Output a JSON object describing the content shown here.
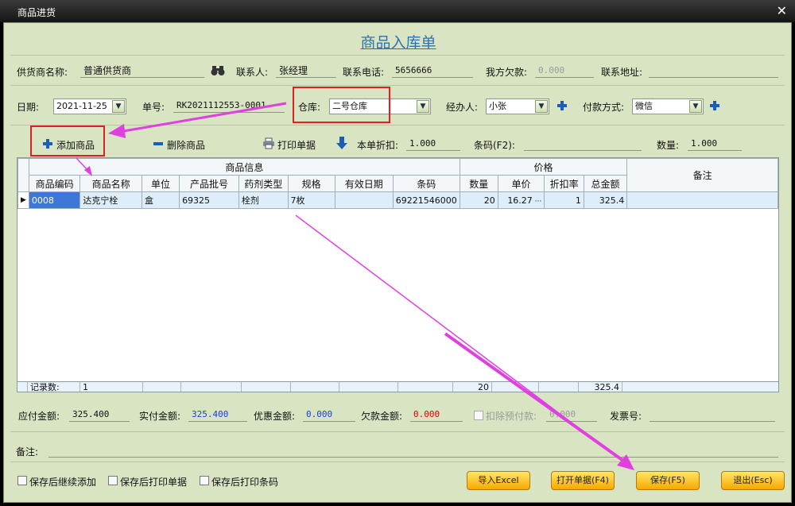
{
  "window": {
    "title": "商品进货",
    "close_glyph": "✕"
  },
  "form": {
    "heading": "商品入库单",
    "supplier_label": "供货商名称:",
    "supplier_value": "普通供货商",
    "contact_label": "联系人:",
    "contact_value": "张经理",
    "phone_label": "联系电话:",
    "phone_value": "5656666",
    "debt_label": "我方欠款:",
    "debt_value": "0.000",
    "address_label": "联系地址:",
    "address_value": "",
    "date_label": "日期:",
    "date_value": "2021-11-25",
    "order_label": "单号:",
    "order_value": "RK2021112553-0001",
    "warehouse_label": "仓库:",
    "warehouse_value": "二号仓库",
    "handler_label": "经办人:",
    "handler_value": "小张",
    "payment_label": "付款方式:",
    "payment_value": "微信"
  },
  "toolbar": {
    "add_label": "添加商品",
    "delete_label": "删除商品",
    "print_label": "打印单据",
    "discount_label": "本单折扣:",
    "discount_value": "1.000",
    "barcode_label": "条码(F2):",
    "barcode_value": "",
    "qty_label": "数量:",
    "qty_value": "1.000"
  },
  "grid": {
    "group_product": "商品信息",
    "group_price": "价格",
    "group_remark": "备注",
    "columns": [
      "商品编码",
      "商品名称",
      "单位",
      "产品批号",
      "药剂类型",
      "规格",
      "有效日期",
      "条码",
      "数量",
      "单价",
      "折扣率",
      "总金额"
    ],
    "row": {
      "code": "0008",
      "name": "达克宁栓",
      "unit": "盒",
      "batch": "69325",
      "type": "栓剂",
      "spec": "7枚",
      "expiry": "",
      "barcode": "69221546000",
      "qty": "20",
      "price": "16.27",
      "discount": "1",
      "total": "325.4"
    },
    "footer": {
      "label": "记录数:",
      "count": "1",
      "qty": "20",
      "total": "325.4"
    }
  },
  "totals": {
    "payable_label": "应付金额:",
    "payable_value": "325.400",
    "actual_label": "实付金额:",
    "actual_value": "325.400",
    "discount_label": "优惠金额:",
    "discount_value": "0.000",
    "owed_label": "欠款金额:",
    "owed_value": "0.000",
    "prepay_label": "扣除预付款:",
    "prepay_value": "0.000",
    "invoice_label": "发票号:",
    "invoice_value": ""
  },
  "remark": {
    "label": "备注:",
    "value": ""
  },
  "options": [
    "保存后继续添加",
    "保存后打印单据",
    "保存后打印条码"
  ],
  "buttons": {
    "import": "导入Excel",
    "open": "打开单据(F4)",
    "save": "保存(F5)",
    "exit": "退出(Esc)"
  },
  "colors": {
    "accent": "#2d73b0",
    "annotation": "#e040e0",
    "highlight_box": "#e02020",
    "button": "#f7a800"
  }
}
